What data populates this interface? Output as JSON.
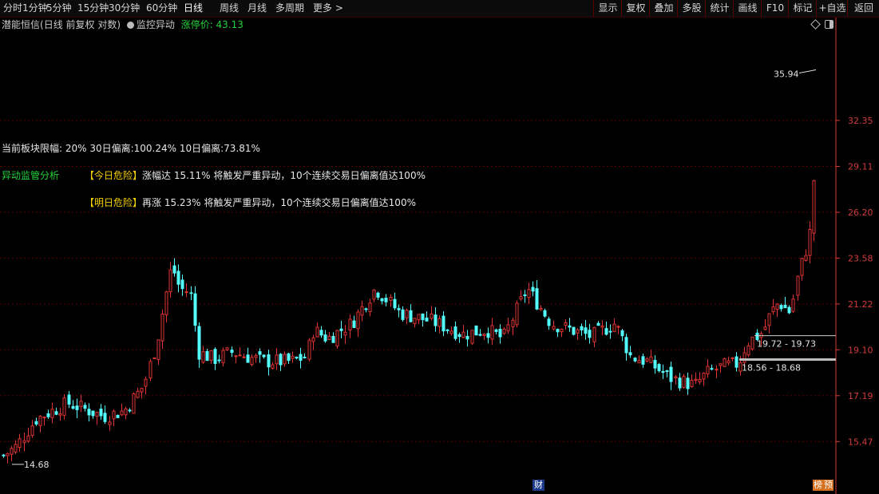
{
  "toolbar": {
    "left_items": [
      "分时",
      "1分钟",
      "5分钟",
      "15分钟",
      "30分钟",
      "60分钟",
      "日线",
      "周线",
      "月线",
      "多周期",
      "更多 >"
    ],
    "active": "日线",
    "right_items": [
      "显示",
      "复权",
      "叠加",
      "多股",
      "统计",
      "画线",
      "F10",
      "标记",
      "+自选",
      "返回"
    ]
  },
  "header": {
    "stock_name": "潜能恒信",
    "chart_mode": "(日线 前复权 对数)",
    "monitor_label": "监控异动",
    "limit_price_label": "涨停价: 43.13"
  },
  "info": {
    "board_limit": "当前板块限幅: 20%  30日偏离:100.24%  10日偏离:73.81%",
    "monitor_title": "异动监管分析",
    "today_tag": "【今日危险】",
    "today_text": "涨幅达 15.11% 将触发严重异动，10个连续交易日偏离值达100%",
    "tomorrow_tag": "【明日危险】",
    "tomorrow_text": "再涨 15.23% 将触发严重异动，10个连续交易日偏离值达100%"
  },
  "chart_data": {
    "type": "candlestick",
    "y_scale": "log",
    "ylim": [
      14.2,
      39.5
    ],
    "y_ticks": [
      15.47,
      17.19,
      19.1,
      21.22,
      23.58,
      26.2,
      29.11,
      32.35
    ],
    "y_tick_labels": [
      "15.47",
      "17.19",
      "19.10",
      "21.22",
      "23.58",
      "26.20",
      "29.11",
      "32.35"
    ],
    "grid": true,
    "annotations": {
      "high": "35.94",
      "low": "14.68",
      "range_upper": "19.72 - 19.73",
      "range_lower": "18.56 - 18.68"
    },
    "markers": {
      "cai": "财",
      "bang": "榜",
      "yu": "预"
    },
    "colors": {
      "up": "#e03333",
      "down": "#54ffff",
      "grid": "#5a0000",
      "axis": "#d23b3b"
    }
  }
}
